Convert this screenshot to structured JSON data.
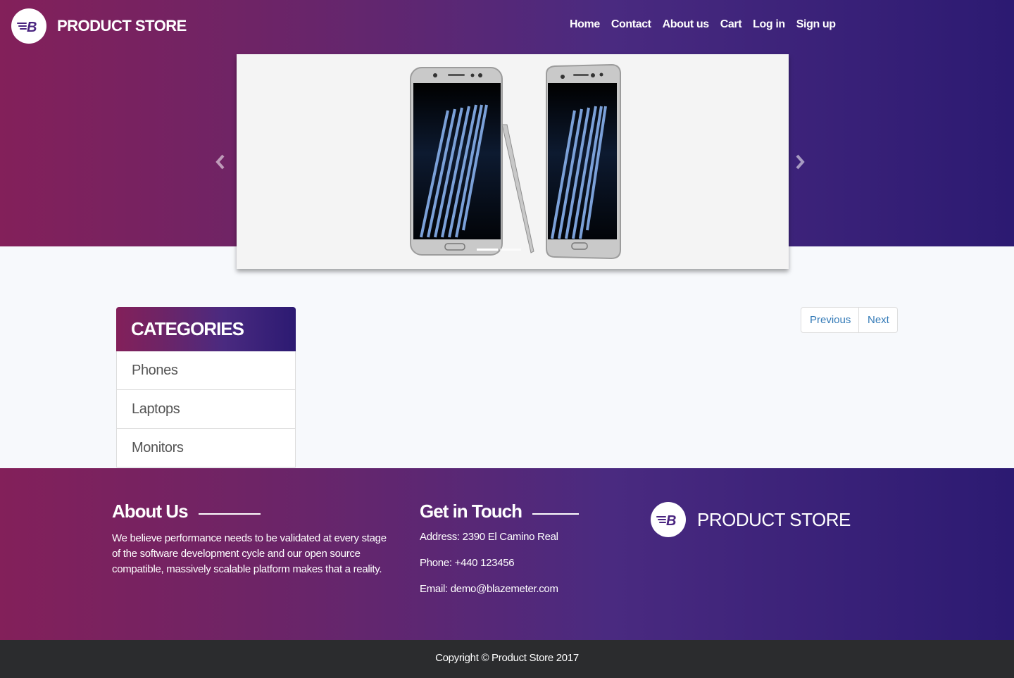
{
  "header": {
    "brand": "PRODUCT STORE",
    "logo_letter": "B",
    "nav": [
      {
        "label": "Home"
      },
      {
        "label": "Contact"
      },
      {
        "label": "About us"
      },
      {
        "label": "Cart"
      },
      {
        "label": "Log in"
      },
      {
        "label": "Sign up"
      }
    ]
  },
  "carousel": {
    "slide_count": 3,
    "active_slide": 1,
    "image": "samsung-phones-with-stylus"
  },
  "categories": {
    "title": "CATEGORIES",
    "items": [
      {
        "label": "Phones"
      },
      {
        "label": "Laptops"
      },
      {
        "label": "Monitors"
      }
    ]
  },
  "pager": {
    "previous": "Previous",
    "next": "Next"
  },
  "footer": {
    "about_title": "About Us",
    "about_text": "We believe performance needs to be validated at every stage of the software development cycle and our open source compatible, massively scalable platform makes that a reality.",
    "contact_title": "Get in Touch",
    "address": "Address: 2390 El Camino Real",
    "phone": "Phone: +440 123456",
    "email": "Email: demo@blazemeter.com",
    "brand": "PRODUCT STORE"
  },
  "copyright": "Copyright © Product Store 2017",
  "colors": {
    "gradient_start": "#83205a",
    "gradient_end": "#2c1a72",
    "link": "#337ab7",
    "copyright_bg": "#2b2c2e"
  }
}
